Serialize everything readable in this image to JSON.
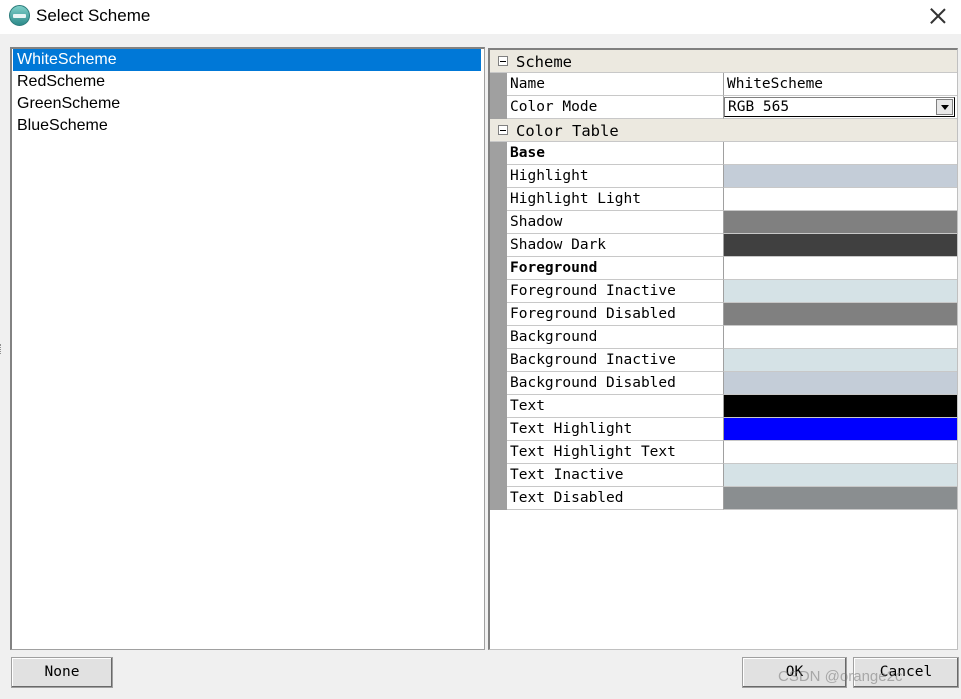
{
  "window": {
    "title": "Select Scheme",
    "icon": "app-logo-icon"
  },
  "schemes": [
    {
      "label": "WhiteScheme",
      "selected": true
    },
    {
      "label": "RedScheme",
      "selected": false
    },
    {
      "label": "GreenScheme",
      "selected": false
    },
    {
      "label": "BlueScheme",
      "selected": false
    }
  ],
  "properties": {
    "scheme_category": "Scheme",
    "name_label": "Name",
    "name_value": "WhiteScheme",
    "color_mode_label": "Color Mode",
    "color_mode_value": "RGB 565",
    "color_table_category": "Color Table",
    "colors": [
      {
        "label": "Base",
        "bold": true,
        "color": "#ffffff"
      },
      {
        "label": "Highlight",
        "bold": false,
        "color": "#c4cdd8"
      },
      {
        "label": "Highlight Light",
        "bold": false,
        "color": "#ffffff"
      },
      {
        "label": "Shadow",
        "bold": false,
        "color": "#808080"
      },
      {
        "label": "Shadow Dark",
        "bold": false,
        "color": "#404040"
      },
      {
        "label": "Foreground",
        "bold": true,
        "color": "#ffffff"
      },
      {
        "label": "Foreground Inactive",
        "bold": false,
        "color": "#d5e2e6"
      },
      {
        "label": "Foreground Disabled",
        "bold": false,
        "color": "#808080"
      },
      {
        "label": "Background",
        "bold": false,
        "color": "#ffffff"
      },
      {
        "label": "Background Inactive",
        "bold": false,
        "color": "#d5e2e6"
      },
      {
        "label": "Background Disabled",
        "bold": false,
        "color": "#c4cdd8"
      },
      {
        "label": "Text",
        "bold": false,
        "color": "#000000"
      },
      {
        "label": "Text Highlight",
        "bold": false,
        "color": "#0000ff"
      },
      {
        "label": "Text Highlight Text",
        "bold": false,
        "color": "#ffffff"
      },
      {
        "label": "Text Inactive",
        "bold": false,
        "color": "#d5e2e6"
      },
      {
        "label": "Text Disabled",
        "bold": false,
        "color": "#8a8e90"
      }
    ]
  },
  "buttons": {
    "none": "None",
    "ok": "OK",
    "cancel": "Cancel"
  },
  "watermark": "CSDN @orange2c"
}
